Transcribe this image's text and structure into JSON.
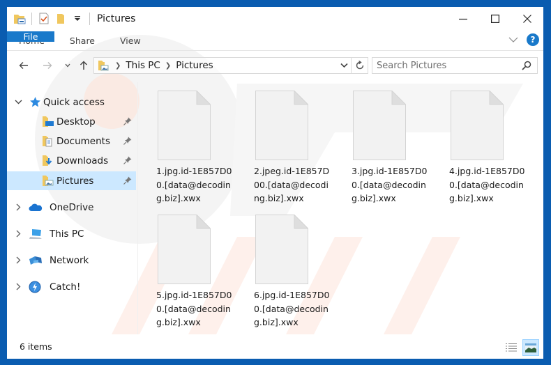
{
  "window": {
    "title": "Pictures",
    "controls": {
      "minimize": "minimize",
      "maximize": "maximize",
      "close": "close"
    }
  },
  "quick_access_toolbar": {
    "icons": [
      "folder-properties-icon",
      "checkmark-document-icon",
      "new-folder-icon",
      "customize-dropdown-icon"
    ]
  },
  "ribbon": {
    "tabs": [
      {
        "label": "File",
        "active": true
      },
      {
        "label": "Home"
      },
      {
        "label": "Share"
      },
      {
        "label": "View"
      }
    ],
    "help_label": "?"
  },
  "navigation": {
    "breadcrumb": [
      "This PC",
      "Pictures"
    ],
    "search_placeholder": "Search Pictures"
  },
  "sidebar": {
    "items": [
      {
        "label": "Quick access",
        "icon": "star-icon",
        "expander": "expanded",
        "level": 0
      },
      {
        "label": "Desktop",
        "icon": "desktop-folder-icon",
        "pinned": true,
        "level": 1
      },
      {
        "label": "Documents",
        "icon": "documents-folder-icon",
        "pinned": true,
        "level": 1
      },
      {
        "label": "Downloads",
        "icon": "downloads-folder-icon",
        "pinned": true,
        "level": 1
      },
      {
        "label": "Pictures",
        "icon": "pictures-folder-icon",
        "pinned": true,
        "level": 1,
        "selected": true
      },
      {
        "label": "OneDrive",
        "icon": "onedrive-cloud-icon",
        "expander": "collapsed",
        "level": 0
      },
      {
        "label": "This PC",
        "icon": "computer-icon",
        "expander": "collapsed",
        "level": 0
      },
      {
        "label": "Network",
        "icon": "network-icon",
        "expander": "collapsed",
        "level": 0
      },
      {
        "label": "Catch!",
        "icon": "catch-icon",
        "expander": "collapsed",
        "level": 0
      }
    ]
  },
  "files": [
    {
      "name": "1.jpg.id-1E857D00.[data@decoding.biz].xwx",
      "lines": [
        "1.jpg.id-1E857D0",
        "0.[data@decodin",
        "g.biz].xwx"
      ]
    },
    {
      "name": "2.jpeg.id-1E857D00.[data@decoding.biz].xwx",
      "lines": [
        "2.jpeg.id-1E857D",
        "00.[data@decodi",
        "ng.biz].xwx"
      ]
    },
    {
      "name": "3.jpg.id-1E857D00.[data@decoding.biz].xwx",
      "lines": [
        "3.jpg.id-1E857D0",
        "0.[data@decodin",
        "g.biz].xwx"
      ]
    },
    {
      "name": "4.jpg.id-1E857D00.[data@decoding.biz].xwx",
      "lines": [
        "4.jpg.id-1E857D0",
        "0.[data@decodin",
        "g.biz].xwx"
      ]
    },
    {
      "name": "5.jpg.id-1E857D00.[data@decoding.biz].xwx",
      "lines": [
        "5.jpg.id-1E857D0",
        "0.[data@decodin",
        "g.biz].xwx"
      ]
    },
    {
      "name": "6.jpg.id-1E857D00.[data@decoding.biz].xwx",
      "lines": [
        "6.jpg.id-1E857D0",
        "0.[data@decodin",
        "g.biz].xwx"
      ]
    }
  ],
  "status": {
    "item_count": "6 items",
    "view_modes": [
      {
        "name": "details-view",
        "active": false
      },
      {
        "name": "large-icons-view",
        "active": true
      }
    ]
  },
  "colors": {
    "frame": "#0a5cb0",
    "accent": "#1979ca",
    "selection": "#cce8ff",
    "folder": "#f0c75e"
  }
}
